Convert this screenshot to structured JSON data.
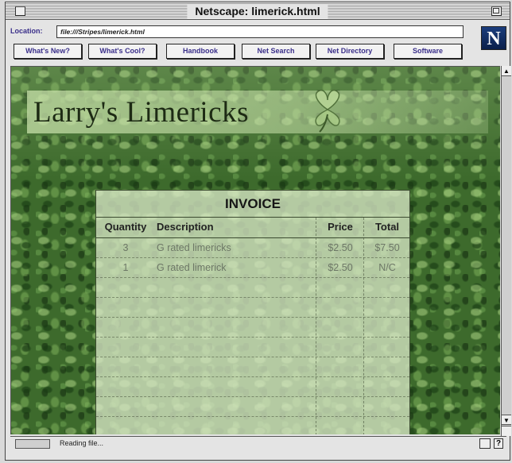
{
  "window": {
    "title": "Netscape: limerick.html"
  },
  "location": {
    "label": "Location:",
    "url": "file:///Stripes/limerick.html"
  },
  "directory_buttons": [
    "What's New?",
    "What's Cool?",
    "Handbook",
    "Net Search",
    "Net Directory",
    "Software"
  ],
  "logo": {
    "letter": "N"
  },
  "page": {
    "title": "Larry's Limericks"
  },
  "invoice": {
    "title": "INVOICE",
    "columns": [
      "Quantity",
      "Description",
      "Price",
      "Total"
    ],
    "rows": [
      {
        "quantity": "3",
        "description": "G rated limericks",
        "price": "$2.50",
        "total": "$7.50"
      },
      {
        "quantity": "1",
        "description": "G rated limerick",
        "price": "$2.50",
        "total": "N/C"
      }
    ]
  },
  "status": {
    "text": "Reading file..."
  },
  "colors": {
    "link_text": "#3a2f8a",
    "clover_background": "#3d6a2c",
    "invoice_panel": "#d6e6c4"
  }
}
